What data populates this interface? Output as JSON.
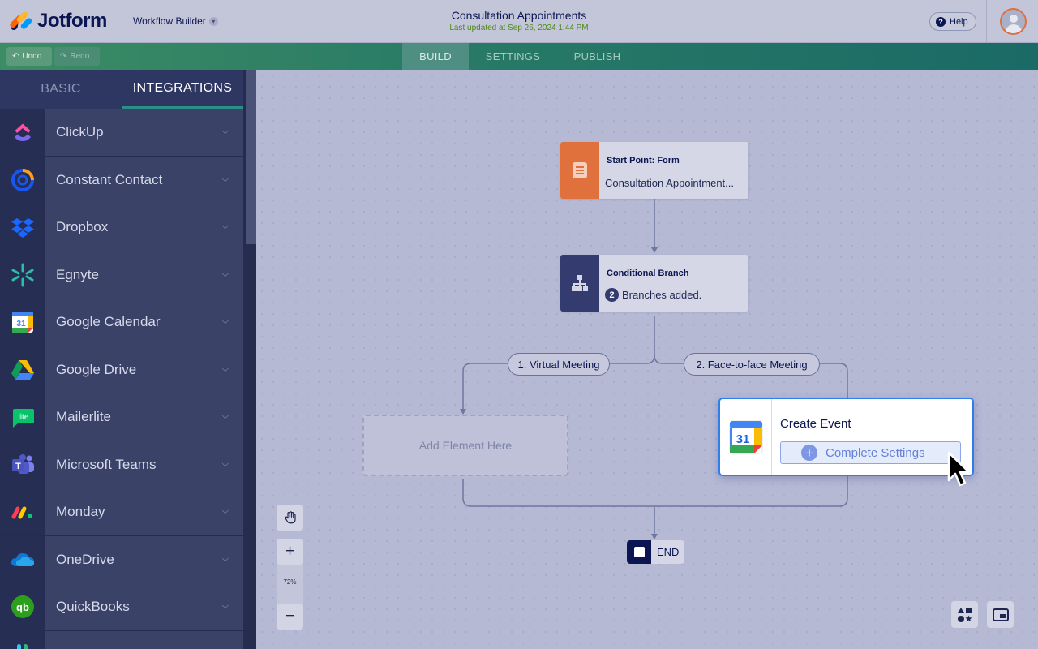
{
  "header": {
    "brand": "Jotform",
    "builder_label": "Workflow Builder",
    "title": "Consultation Appointments",
    "last_updated": "Last updated at Sep 26, 2024 1:44 PM",
    "help_label": "Help"
  },
  "toolbar": {
    "undo_label": "Undo",
    "redo_label": "Redo",
    "tabs": [
      {
        "label": "BUILD",
        "active": true
      },
      {
        "label": "SETTINGS",
        "active": false
      },
      {
        "label": "PUBLISH",
        "active": false
      }
    ]
  },
  "sidebar": {
    "tabs": [
      {
        "label": "BASIC",
        "active": false
      },
      {
        "label": "INTEGRATIONS",
        "active": true
      }
    ],
    "items": [
      {
        "label": "ClickUp",
        "icon": "clickup-icon"
      },
      {
        "label": "Constant Contact",
        "icon": "constant-contact-icon"
      },
      {
        "label": "Dropbox",
        "icon": "dropbox-icon"
      },
      {
        "label": "Egnyte",
        "icon": "egnyte-icon"
      },
      {
        "label": "Google Calendar",
        "icon": "google-calendar-icon"
      },
      {
        "label": "Google Drive",
        "icon": "google-drive-icon"
      },
      {
        "label": "Mailerlite",
        "icon": "mailerlite-icon"
      },
      {
        "label": "Microsoft Teams",
        "icon": "microsoft-teams-icon"
      },
      {
        "label": "Monday",
        "icon": "monday-icon"
      },
      {
        "label": "OneDrive",
        "icon": "onedrive-icon"
      },
      {
        "label": "QuickBooks",
        "icon": "quickbooks-icon"
      },
      {
        "label": "",
        "icon": "slack-icon"
      }
    ]
  },
  "flow": {
    "start": {
      "title": "Start Point: Form",
      "subtitle": "Consultation Appointment..."
    },
    "branch": {
      "title": "Conditional Branch",
      "count": "2",
      "subtitle": "Branches added."
    },
    "branch_labels": [
      "1. Virtual Meeting",
      "2. Face-to-face Meeting"
    ],
    "placeholder": "Add Element Here",
    "event": {
      "title": "Create Event",
      "button": "Complete Settings",
      "calendar_day": "31"
    },
    "end_label": "END"
  },
  "controls": {
    "zoom": "72%"
  },
  "colors": {
    "brand_navy": "#0a1551",
    "form_orange": "#e0703c",
    "branch_navy": "#343b6e",
    "accent_blue": "#2f7de8",
    "nav_green": "#287a66"
  }
}
